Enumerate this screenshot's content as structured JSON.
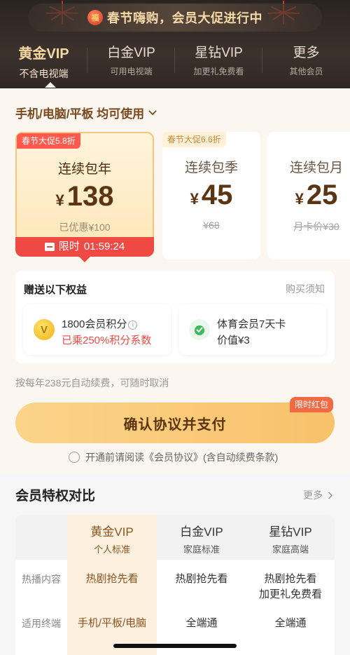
{
  "promo_banner": {
    "text": "春节嗨购，会员大促进行中"
  },
  "tabs": [
    {
      "title": "黄金VIP",
      "subtitle": "不含电视端",
      "active": true
    },
    {
      "title": "白金VIP",
      "subtitle": "可用电视端",
      "active": false
    },
    {
      "title": "星钻VIP",
      "subtitle": "加更礼免费看",
      "active": false
    },
    {
      "title": "更多",
      "subtitle": "其他会员",
      "active": false
    }
  ],
  "device_line": {
    "text": "手机/电脑/平板 均可使用"
  },
  "plans": [
    {
      "tag": "春节大促5.8折",
      "name": "连续包年",
      "currency": "¥",
      "price": "138",
      "sub": "已优惠¥100",
      "countdown_label": "限时",
      "countdown": "01:59:24",
      "selected": true
    },
    {
      "tag": "春节大促6.6折",
      "name": "连续包季",
      "currency": "¥",
      "price": "45",
      "sub": "¥68"
    },
    {
      "tag": "",
      "name": "连续包月",
      "currency": "¥",
      "price": "25",
      "sub": "月卡价¥30"
    }
  ],
  "benefits": {
    "title": "赠送以下权益",
    "notice": "购买须知",
    "items": [
      {
        "line1": "1800会员积分",
        "line2": "已乘250%积分系数",
        "icon": "points-coin-icon"
      },
      {
        "line1": "体育会员7天卡",
        "line2": "价值¥3",
        "icon": "sports-medal-icon"
      }
    ]
  },
  "renew_note": "按每年238元自动续费，可随时取消",
  "pay_button": {
    "label": "确认协议并支付",
    "badge": "限时红包"
  },
  "agreement": {
    "text": "开通前请阅读《会员协议》(含自动续费条款)"
  },
  "compare": {
    "title": "会员特权对比",
    "more": "更多",
    "columns": [
      {
        "name": "黄金VIP",
        "desc": "个人标准"
      },
      {
        "name": "白金VIP",
        "desc": "家庭标准"
      },
      {
        "name": "星钻VIP",
        "desc": "家庭高端"
      }
    ],
    "rows": [
      {
        "label": "热播内容",
        "values": [
          "热剧抢先看",
          "热剧抢先看",
          "热剧抢先看\n加更礼免费看"
        ]
      },
      {
        "label": "适用终端",
        "values": [
          "手机/平板/电脑",
          "全端通",
          "全端通"
        ]
      }
    ]
  },
  "colors": {
    "accent_gold": "#f6d9a2",
    "brand_brown": "#5a3413",
    "promo_red": "#ee4a43"
  }
}
